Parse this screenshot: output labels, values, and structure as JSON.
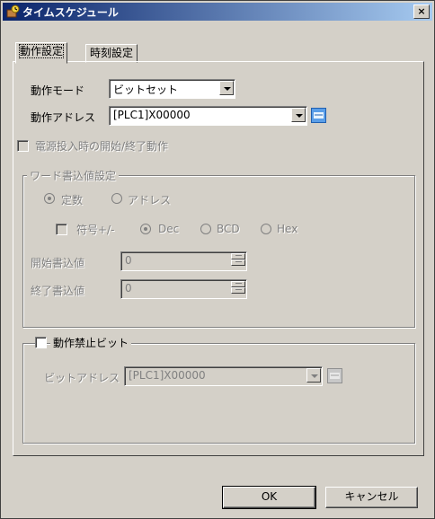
{
  "window": {
    "title": "タイムスケジュール",
    "close_glyph": "×"
  },
  "tabs": [
    {
      "label": "動作設定"
    },
    {
      "label": "時刻設定"
    }
  ],
  "action_mode": {
    "label": "動作モード",
    "value": "ビットセット"
  },
  "action_address": {
    "label": "動作アドレス",
    "value": "[PLC1]X00000"
  },
  "power_on_option": {
    "label": "電源投入時の開始/終了動作"
  },
  "word_write": {
    "group_title": "ワード書込値設定",
    "constant_label": "定数",
    "address_label": "アドレス",
    "sign_label": "符号+/-",
    "dec_label": "Dec",
    "bcd_label": "BCD",
    "hex_label": "Hex",
    "start_label": "開始書込値",
    "start_value": "0",
    "end_label": "終了書込値",
    "end_value": "0"
  },
  "disable_bit": {
    "group_title": "動作禁止ビット",
    "bit_address_label": "ビットアドレス",
    "bit_address_value": "[PLC1]X00000"
  },
  "buttons": {
    "ok": "OK",
    "cancel": "キャンセル"
  }
}
